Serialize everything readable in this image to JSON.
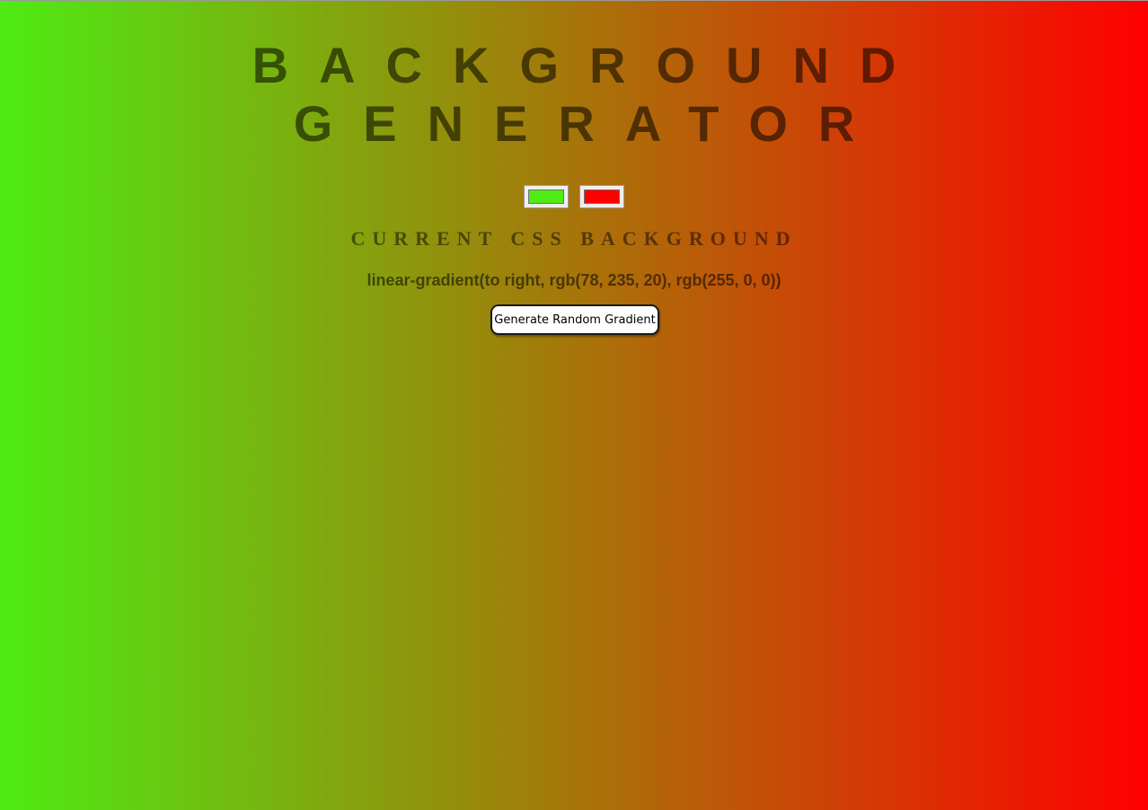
{
  "title": {
    "line1": "BACKGROUND",
    "line2": "GENERATOR"
  },
  "colors": {
    "color1": "#4eeb14",
    "color2": "#ff0000"
  },
  "subtitle": "CURRENT CSS BACKGROUND",
  "css_value": "linear-gradient(to right, rgb(78, 235, 20), rgb(255, 0, 0))",
  "button_label": "Generate Random Gradient"
}
